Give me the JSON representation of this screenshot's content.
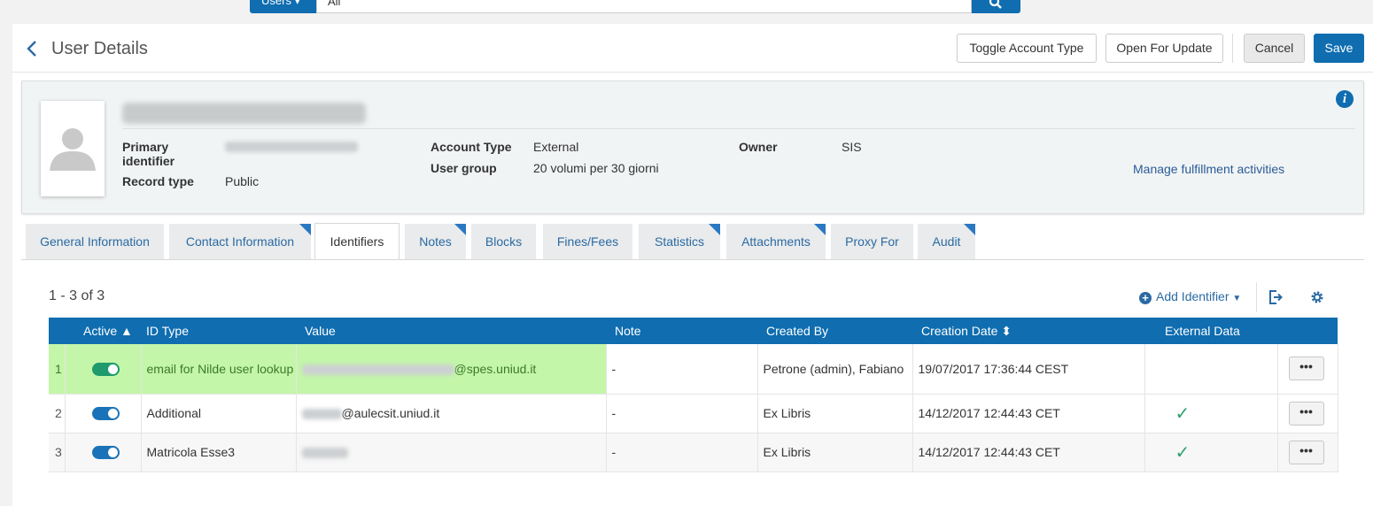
{
  "search": {
    "scope_label": "Users ▾",
    "scope_value": "All",
    "colors": {
      "primary": "#0f6db0"
    }
  },
  "header": {
    "title": "User Details",
    "buttons": {
      "toggle_account": "Toggle Account Type",
      "open_update": "Open For Update",
      "cancel": "Cancel",
      "save": "Save"
    }
  },
  "user": {
    "primary_identifier_label": "Primary identifier",
    "record_type_label": "Record type",
    "record_type": "Public",
    "account_type_label": "Account Type",
    "account_type": "External",
    "user_group_label": "User group",
    "user_group": "20 volumi per 30 giorni",
    "owner_label": "Owner",
    "owner": "SIS",
    "manage_link": "Manage fulfillment activities"
  },
  "tabs": [
    {
      "label": "General Information",
      "active": false
    },
    {
      "label": "Contact Information",
      "active": false
    },
    {
      "label": "Identifiers",
      "active": true
    },
    {
      "label": "Notes",
      "active": false
    },
    {
      "label": "Blocks",
      "active": false
    },
    {
      "label": "Fines/Fees",
      "active": false
    },
    {
      "label": "Statistics",
      "active": false
    },
    {
      "label": "Attachments",
      "active": false
    },
    {
      "label": "Proxy For",
      "active": false
    },
    {
      "label": "Audit",
      "active": false
    }
  ],
  "list": {
    "count": "1 - 3 of 3",
    "add_identifier": "Add Identifier",
    "columns": [
      "",
      "Active ▲",
      "ID Type",
      "Value",
      "Note",
      "Created By",
      "Creation Date ⬍",
      "External Data",
      ""
    ],
    "rows": [
      {
        "num": "1",
        "active": true,
        "id_type": "email for Nilde user lookup",
        "value_suffix": "@spes.uniud.it",
        "note": "-",
        "created_by": "Petrone (admin), Fabiano",
        "creation_date": "19/07/2017 17:36:44 CEST",
        "external": "",
        "action": "•••"
      },
      {
        "num": "2",
        "active": true,
        "id_type": "Additional",
        "value_suffix": "@aulecsit.uniud.it",
        "note": "-",
        "created_by": "Ex Libris",
        "creation_date": "14/12/2017 12:44:43 CET",
        "external": "✓",
        "action": "•••"
      },
      {
        "num": "3",
        "active": true,
        "id_type": "Matricola Esse3",
        "value_suffix": "",
        "note": "-",
        "created_by": "Ex Libris",
        "creation_date": "14/12/2017 12:44:43 CET",
        "external": "✓",
        "action": "•••"
      }
    ],
    "toggle_colors": [
      "#1e9a6c",
      "#1a73b8",
      "#1a73b8"
    ],
    "highlight_color": "#c3f6a9"
  }
}
